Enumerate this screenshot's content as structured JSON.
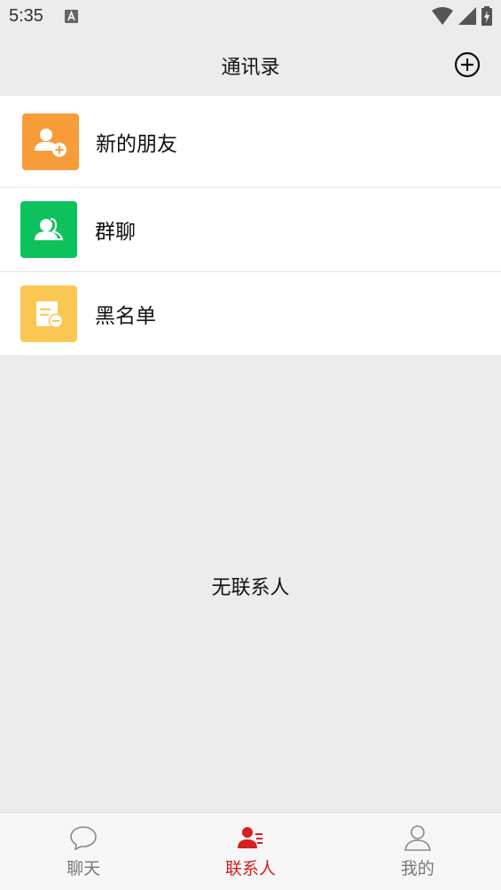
{
  "status_bar": {
    "time": "5:35"
  },
  "header": {
    "title": "通讯录"
  },
  "menu": [
    {
      "label": "新的朋友",
      "icon": "add-friend-icon",
      "color": "#f89c3a"
    },
    {
      "label": "群聊",
      "icon": "group-chat-icon",
      "color": "#0dc25d"
    },
    {
      "label": "黑名单",
      "icon": "blacklist-icon",
      "color": "#fcc653"
    }
  ],
  "empty_message": "无联系人",
  "tabs": [
    {
      "label": "聊天",
      "icon": "chat-bubble-icon",
      "active": false
    },
    {
      "label": "联系人",
      "icon": "contacts-icon",
      "active": true
    },
    {
      "label": "我的",
      "icon": "person-icon",
      "active": false
    }
  ],
  "colors": {
    "active_tab": "#d42020",
    "inactive_tab": "#777777",
    "background": "#ececec"
  }
}
